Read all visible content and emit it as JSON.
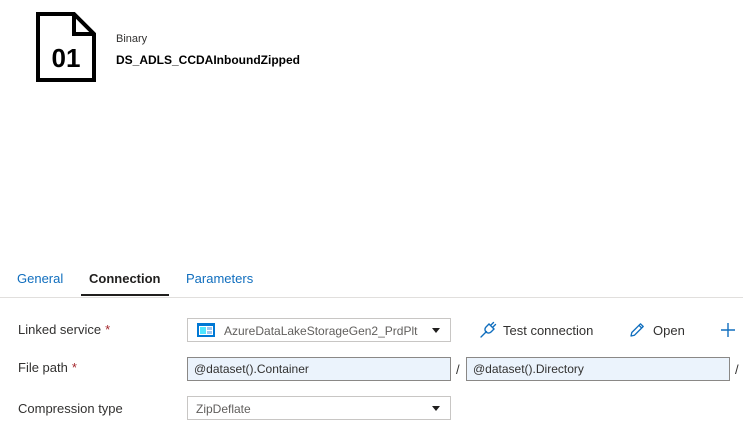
{
  "dataset": {
    "type_label": "Binary",
    "name": "DS_ADLS_CCDAInboundZipped",
    "icon_text": "01",
    "icon": "binary-file-icon"
  },
  "tabs": [
    {
      "label": "General",
      "active": false
    },
    {
      "label": "Connection",
      "active": true
    },
    {
      "label": "Parameters",
      "active": false
    }
  ],
  "linked_service": {
    "label": "Linked service",
    "required_marker": "*",
    "value": "AzureDataLakeStorageGen2_PrdPlt",
    "icon": "storage-icon"
  },
  "actions": {
    "test_connection": "Test connection",
    "open": "Open",
    "new_icon": "plus-icon"
  },
  "file_path": {
    "label": "File path",
    "required_marker": "*",
    "container": "@dataset().Container",
    "directory": "@dataset().Directory",
    "separator": "/"
  },
  "compression": {
    "label": "Compression type",
    "value": "ZipDeflate"
  },
  "colors": {
    "link": "#106ebe",
    "required": "#a4262c",
    "input_bg": "#ebf3fc",
    "storage_icon": "#0078d4"
  }
}
